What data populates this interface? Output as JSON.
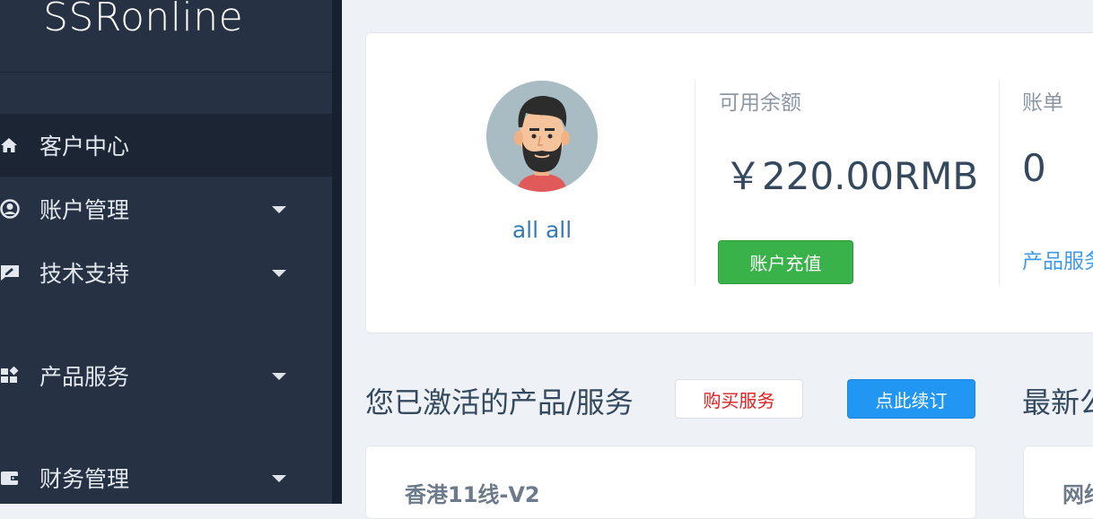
{
  "brand": {
    "name": "SSRonline"
  },
  "sidebar": {
    "items": [
      {
        "label": "客户中心",
        "icon": "home-icon",
        "expandable": false,
        "active": true
      },
      {
        "label": "账户管理",
        "icon": "user-circle-icon",
        "expandable": true
      },
      {
        "label": "技术支持",
        "icon": "support-ticket-icon",
        "expandable": true
      },
      {
        "label": "产品服务",
        "icon": "cubes-icon",
        "expandable": true
      },
      {
        "label": "财务管理",
        "icon": "wallet-icon",
        "expandable": true
      }
    ]
  },
  "profile": {
    "username": "all all",
    "avatar_icon": "bearded-man-avatar-icon"
  },
  "balance": {
    "label": "可用余额",
    "value": "￥220.00RMB",
    "recharge_button": "账户充值"
  },
  "bills": {
    "label": "账单",
    "value": "0",
    "link": "产品服务"
  },
  "services": {
    "title": "您已激活的产品/服务",
    "buy_button": "购买服务",
    "renew_button": "点此续订",
    "first_product": "香港11线-V2"
  },
  "news": {
    "title": "最新公告",
    "first_item": "网络"
  },
  "colors": {
    "sidebar": "#263244",
    "accent_green": "#3ab24a",
    "accent_blue": "#2196f3",
    "link_blue": "#337ab7",
    "danger_red": "#e0201e"
  }
}
